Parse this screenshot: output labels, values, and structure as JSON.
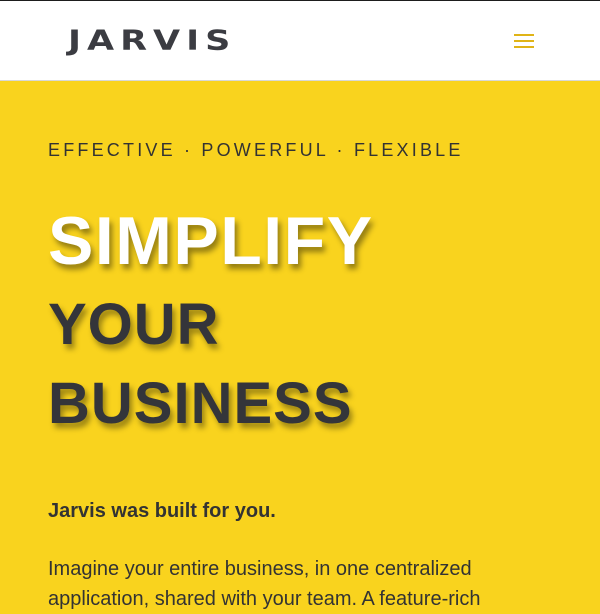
{
  "header": {
    "logo_text": "JARVIS",
    "menu_icon": "hamburger-menu-icon"
  },
  "hero": {
    "tagline": "EFFECTIVE · POWERFUL · FLEXIBLE",
    "headline_line1": "SIMPLIFY",
    "headline_line2": "YOUR",
    "headline_line3": "BUSINESS",
    "lead": "Jarvis was built for you.",
    "body": "Imagine your entire business, in one centralized application, shared with your team. A feature-rich"
  },
  "colors": {
    "background": "#f9d31e",
    "header_background": "#ffffff",
    "accent": "#e0b417",
    "headline_dark": "#34353a",
    "headline_light": "#ffffff",
    "text": "#333333"
  }
}
